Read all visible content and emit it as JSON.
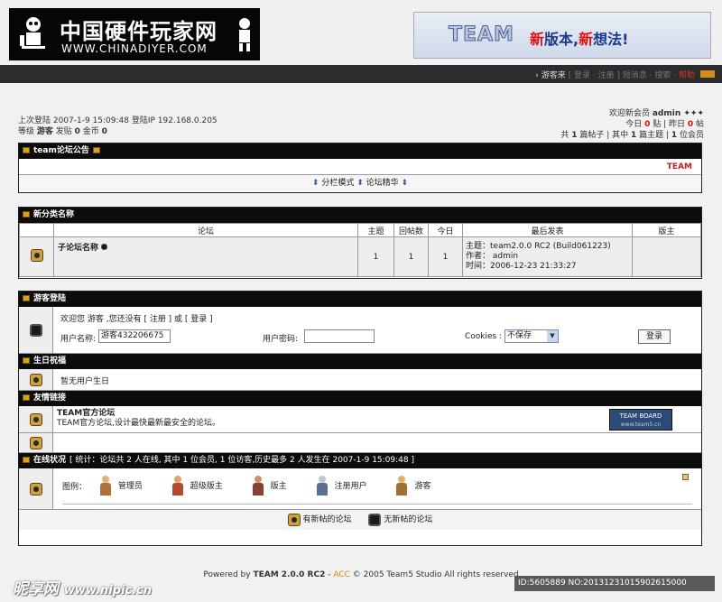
{
  "header": {
    "logo_cn": "中国硬件玩家网",
    "logo_en": "WWW.CHINADIYER.COM",
    "banner_team": "TEAM",
    "banner_slogan_1": "新",
    "banner_slogan_2": "版本,",
    "banner_slogan_3": "新",
    "banner_slogan_4": "想法!"
  },
  "topnav": {
    "links": [
      {
        "text": "› 游客来 ",
        "style": "normal"
      },
      {
        "text": "[ 登录 · 注册 ]",
        "style": "dim"
      },
      {
        "text": " 短消息 · 搜索 · ",
        "style": "dim"
      },
      {
        "text": "帮助",
        "style": "red"
      }
    ]
  },
  "userinfo": {
    "last_login": "上次登陆 2007-1-9 15:09:48 登陆IP 192.168.0.205",
    "level_prefix": "等级 ",
    "level": "游客",
    "posts_prefix": " 发贴 ",
    "posts": "0",
    "gold_prefix": " 金币 ",
    "gold": "0",
    "welcome_prefix": "欢迎新会员 ",
    "welcome_user": "admin",
    "welcome_suffix": " ✦✦✦",
    "today_prefix": "今日 ",
    "today": "0",
    "today_mid": " 贴 | 昨日 ",
    "yesterday": "0",
    "yesterday_suffix": " 帖",
    "total_prefix": "共 ",
    "total": "1",
    "total_mid": " 篇帖子 | 其中 ",
    "topics": "1",
    "topics_mid": " 篇主题 | ",
    "members": "1",
    "members_suffix": " 位会员"
  },
  "announce": {
    "title": "team论坛公告",
    "marquee": "TEAM",
    "mode_left": "分栏模式",
    "mode_right": "论坛精华"
  },
  "forum": {
    "category_title": "新分类名称",
    "columns": [
      "论坛",
      "主题",
      "回帖数",
      "今日",
      "最后发表",
      "版主"
    ],
    "row": {
      "name": "子论坛名称",
      "topics": "1",
      "replies": "1",
      "today": "1",
      "last_topic": "主题：team2.0.0 RC2 (Build061223)",
      "last_author": "作者： admin",
      "last_time": "时间：2006-12-23 21:33:27",
      "moderator": ""
    }
  },
  "guest_login": {
    "title": "游客登陆",
    "welcome": "欢迎您 游客 ,您还没有 [ 注册 ] 或 [ 登录 ]",
    "username_label": "用户名称:",
    "username_value": "游客432206675",
    "password_label": "用户密码:",
    "cookies_label": "Cookies :",
    "cookies_value": "不保存",
    "login_button": "登录"
  },
  "birthday": {
    "title": "生日祝福",
    "text": "暂无用户生日"
  },
  "links": {
    "title": "友情链接",
    "site_name": "TEAM官方论坛",
    "site_desc": "TEAM官方论坛,设计最快最新最安全的论坛。",
    "badge_top": "TEAM BOARD",
    "badge_bottom": "www.team5.cn"
  },
  "online": {
    "title": "在线状况",
    "stats": "[ 统计：论坛共 2 人在线, 其中 1 位会员, 1 位访客,历史最多 2 人发生在 2007-1-9 15:09:48 ]",
    "legend_label": "图例：",
    "legend": [
      "管理员",
      "超级版主",
      "版主",
      "注册用户",
      "游客"
    ],
    "legend_colors": [
      "#b0703a",
      "#b04a2a",
      "#8a4030",
      "#5a7090",
      "#a07030"
    ]
  },
  "icon_legend": {
    "new_posts": "有新帖的论坛",
    "no_new_posts": "无新帖的论坛"
  },
  "footer": {
    "prefix": "Powered by ",
    "product": "TEAM 2.0.0 RC2",
    "sep": " - ",
    "acc": "ACC",
    "suffix": " © 2005 Team5 Studio All rights reserved"
  },
  "watermark": {
    "left": "昵享网",
    "left_url": "www.nipic.cn",
    "right": "ID:5605889 NO:20131231015902615000"
  }
}
